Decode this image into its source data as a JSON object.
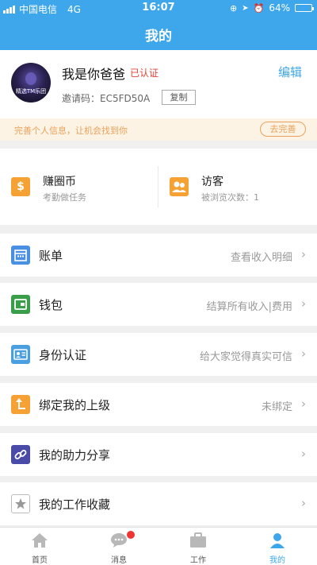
{
  "status_bar": {
    "carrier": "中国电信",
    "network": "4G",
    "time": "16:07",
    "battery": "64%",
    "battery_level": 0.64
  },
  "header": {
    "title": "我的"
  },
  "profile": {
    "name": "我是你爸爸",
    "verified": "已认证",
    "edit": "编辑",
    "invite_label": "邀请码：",
    "invite_code": "EC5FD50A",
    "copy": "复制",
    "avatar_caption": "精选TM乐团"
  },
  "notice": {
    "text": "完善个人信息，让机会找到你",
    "button": "去完善"
  },
  "quick": [
    {
      "title": "赚圈币",
      "subtitle": "考勤做任务",
      "icon": "dollar-icon"
    },
    {
      "title": "访客",
      "subtitle": "被浏览次数：1",
      "icon": "visitors-icon"
    }
  ],
  "menu": [
    {
      "label": "账单",
      "value": "查看收入明细",
      "icon": "calendar-icon",
      "color": "#4a90e2"
    },
    {
      "label": "钱包",
      "value": "结算所有收入|费用",
      "icon": "wallet-icon",
      "color": "#3a9d4a"
    },
    {
      "label": "身份认证",
      "value": "给大家觉得真实可信",
      "icon": "id-card-icon",
      "color": "#4a9fe0"
    },
    {
      "label": "绑定我的上级",
      "value": "未绑定",
      "icon": "bind-up-icon",
      "color": "#f5a133"
    },
    {
      "label": "我的助力分享",
      "value": "",
      "icon": "link-icon",
      "color": "#4a4aa8"
    },
    {
      "label": "我的工作收藏",
      "value": "",
      "icon": "star-icon",
      "color": "#ffffff"
    }
  ],
  "tabs": [
    {
      "label": "首页",
      "icon": "home-icon"
    },
    {
      "label": "消息",
      "icon": "message-icon"
    },
    {
      "label": "工作",
      "icon": "briefcase-icon"
    },
    {
      "label": "我的",
      "icon": "person-icon"
    }
  ],
  "colors": {
    "primary": "#3ea7ec",
    "warning": "#e8a15a",
    "verified": "#e0453a"
  }
}
